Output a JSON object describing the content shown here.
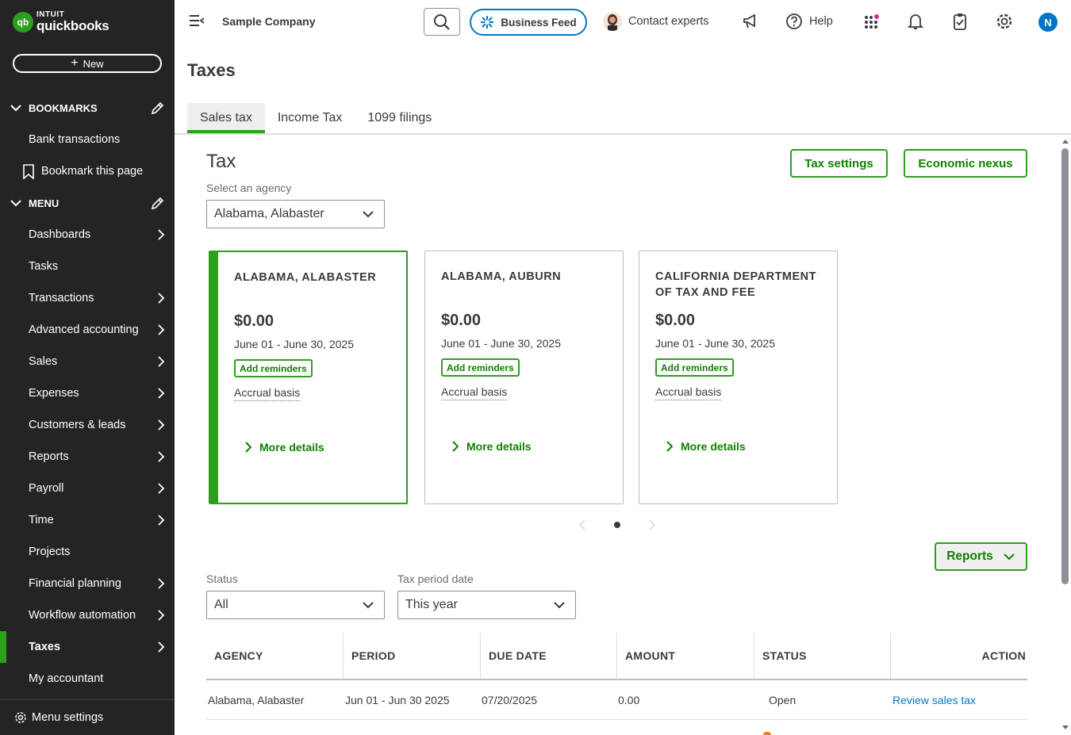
{
  "brand": {
    "intuit": "INTUIT",
    "product": "quickbooks",
    "mark": "qb"
  },
  "sidebar": {
    "new_label": "New",
    "bookmarks_header": "BOOKMARKS",
    "bookmarks": [
      {
        "label": "Bank transactions"
      },
      {
        "label": "Bookmark this page",
        "icon": "bookmark-icon"
      }
    ],
    "menu_header": "MENU",
    "menu_items": [
      {
        "label": "Dashboards",
        "has_arrow": true
      },
      {
        "label": "Tasks",
        "has_arrow": false
      },
      {
        "label": "Transactions",
        "has_arrow": true
      },
      {
        "label": "Advanced accounting",
        "has_arrow": true
      },
      {
        "label": "Sales",
        "has_arrow": true
      },
      {
        "label": "Expenses",
        "has_arrow": true
      },
      {
        "label": "Customers & leads",
        "has_arrow": true
      },
      {
        "label": "Reports",
        "has_arrow": true
      },
      {
        "label": "Payroll",
        "has_arrow": true
      },
      {
        "label": "Time",
        "has_arrow": true
      },
      {
        "label": "Projects",
        "has_arrow": false
      },
      {
        "label": "Financial planning",
        "has_arrow": true
      },
      {
        "label": "Workflow automation",
        "has_arrow": true
      },
      {
        "label": "Taxes",
        "has_arrow": true,
        "active": true
      },
      {
        "label": "My accountant",
        "has_arrow": false
      }
    ],
    "menu_settings": "Menu settings"
  },
  "topbar": {
    "company": "Sample Company",
    "business_feed": "Business Feed",
    "contact_experts": "Contact experts",
    "help": "Help",
    "avatar_initial": "N"
  },
  "page": {
    "title": "Taxes",
    "tabs": [
      {
        "label": "Sales tax",
        "active": true
      },
      {
        "label": "Income Tax"
      },
      {
        "label": "1099 filings"
      }
    ]
  },
  "tax": {
    "title": "Tax",
    "tax_settings": "Tax settings",
    "economic_nexus": "Economic nexus",
    "agency_label": "Select an agency",
    "agency_value": "Alabama, Alabaster",
    "cards": [
      {
        "name": "ALABAMA, ALABASTER",
        "amount": "$0.00",
        "period": "June 01 - June 30, 2025",
        "reminder": "Add reminders",
        "basis": "Accrual basis",
        "more": "More details",
        "selected": true
      },
      {
        "name": "ALABAMA, AUBURN",
        "amount": "$0.00",
        "period": "June 01 - June 30, 2025",
        "reminder": "Add reminders",
        "basis": "Accrual basis",
        "more": "More details"
      },
      {
        "name": "CALIFORNIA DEPARTMENT OF TAX AND FEE",
        "amount": "$0.00",
        "period": "June 01 - June 30, 2025",
        "reminder": "Add reminders",
        "basis": "Accrual basis",
        "more": "More details"
      }
    ],
    "reports_label": "Reports",
    "status_label": "Status",
    "status_value": "All",
    "period_label": "Tax period date",
    "period_value": "This year"
  },
  "table": {
    "headers": [
      "AGENCY",
      "PERIOD",
      "DUE DATE",
      "AMOUNT",
      "STATUS",
      "ACTION"
    ],
    "rows": [
      {
        "agency": "Alabama, Alabaster",
        "period": "Jun 01 - Jun 30 2025",
        "due": "07/20/2025",
        "amount": "0.00",
        "status": "Open",
        "action": "Review sales tax"
      }
    ]
  },
  "colors": {
    "accent_green": "#2ca01c",
    "link_blue": "#0077c5",
    "sidebar_bg": "#242424"
  }
}
